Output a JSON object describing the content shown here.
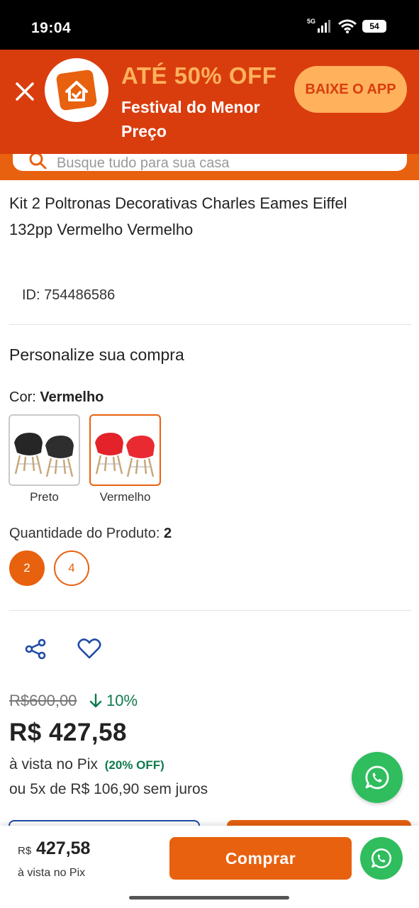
{
  "status_bar": {
    "time": "19:04",
    "network": "5G",
    "battery": "54"
  },
  "promo": {
    "title": "ATÉ 50% OFF",
    "subtitle": "Festival do Menor Preço",
    "cta": "BAIXE O APP",
    "colors": {
      "background": "#d93d0e",
      "accent": "#ffb15c"
    }
  },
  "search": {
    "placeholder": "Busque tudo para sua casa"
  },
  "product": {
    "title": "Kit 2 Poltronas Decorativas Charles Eames Eiffel 132pp Vermelho Vermelho",
    "id": "ID: 754486586"
  },
  "customize": {
    "heading": "Personalize sua compra",
    "color_label": "Cor:",
    "color_value": "Vermelho",
    "colors": [
      {
        "label": "Preto",
        "swatch": "#262626",
        "selected": false
      },
      {
        "label": "Vermelho",
        "swatch": "#e32229",
        "selected": true
      }
    ],
    "quantity_label": "Quantidade do Produto:",
    "quantity_value": "2",
    "quantities": [
      "2",
      "4"
    ]
  },
  "pricing": {
    "old_price": "R$600,00",
    "discount": "10%",
    "price": "R$ 427,58",
    "pix_text": "à vista no Pix",
    "pix_discount": "(20% OFF)",
    "installments": "ou 5x de R$ 106,90 sem juros"
  },
  "bottom_bar": {
    "currency": "R$",
    "price": "427,58",
    "pix_text": "à vista no Pix",
    "buy_label": "Comprar"
  },
  "theme": {
    "accent": "#e8610f",
    "success": "#0e7a4d",
    "whatsapp": "#2fbd5e",
    "link": "#1f4aa8"
  }
}
